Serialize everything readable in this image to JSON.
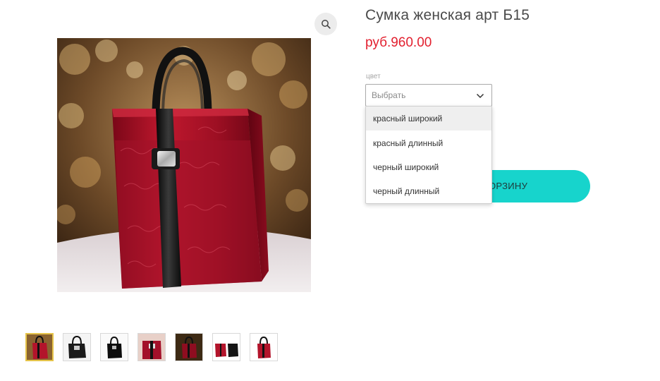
{
  "product": {
    "title": "Сумка женская арт Б15",
    "price": "руб.960.00",
    "color_field_label": "цвет",
    "color_select_value": "Выбрать",
    "color_options": [
      "красный широкий",
      "красный длинный",
      "черный широкий",
      "черный длинный"
    ],
    "add_to_cart_label": "ОРЗИНУ"
  },
  "icons": {
    "zoom": "zoom-in-icon",
    "chevron": "chevron-down-icon"
  },
  "colors": {
    "price": "#e2202f",
    "cart_button": "#17d4cc",
    "thumb_active_border": "#e6c44a"
  },
  "gallery": {
    "thumbnails": [
      "bag-red",
      "bag-black-patent",
      "bag-black",
      "bag-red-closeup",
      "bag-dark-bg",
      "bag-set",
      "bag-black-on-white"
    ],
    "active_index": 0
  }
}
